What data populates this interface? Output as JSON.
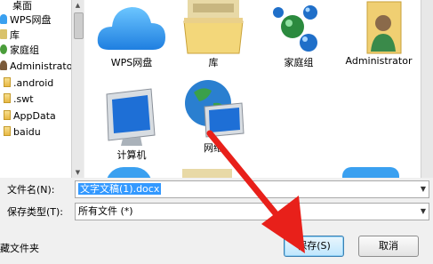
{
  "nav": {
    "items": [
      {
        "label": "桌面",
        "icon": "folder-icon"
      },
      {
        "label": "WPS网盘",
        "icon": "cloud-icon"
      },
      {
        "label": "库",
        "icon": "library-icon"
      },
      {
        "label": "家庭组",
        "icon": "homegroup-icon"
      },
      {
        "label": "Administrator",
        "icon": "user-icon"
      },
      {
        "label": ".android",
        "icon": "folder-icon"
      },
      {
        "label": ".swt",
        "icon": "folder-icon"
      },
      {
        "label": "AppData",
        "icon": "folder-icon"
      },
      {
        "label": "baidu",
        "icon": "folder-icon"
      }
    ]
  },
  "content": {
    "tiles": [
      {
        "label": "WPS网盘",
        "icon": "cloud-icon"
      },
      {
        "label": "库",
        "icon": "library-folder-icon"
      },
      {
        "label": "家庭组",
        "icon": "homegroup-icon"
      },
      {
        "label": "Administrator",
        "icon": "user-folder-icon"
      },
      {
        "label": "计算机",
        "icon": "computer-icon"
      },
      {
        "label": "网络",
        "icon": "network-icon"
      }
    ]
  },
  "form": {
    "filename_label": "文件名(N):",
    "filename_value": "文字文稿(1).docx",
    "filetype_label": "保存类型(T):",
    "filetype_value": "所有文件 (*)"
  },
  "buttons": {
    "save": "保存(S)",
    "cancel": "取消"
  },
  "hide_folders": "藏文件夹",
  "colors": {
    "selection": "#3399ff",
    "annotation_arrow": "#e8201a"
  }
}
